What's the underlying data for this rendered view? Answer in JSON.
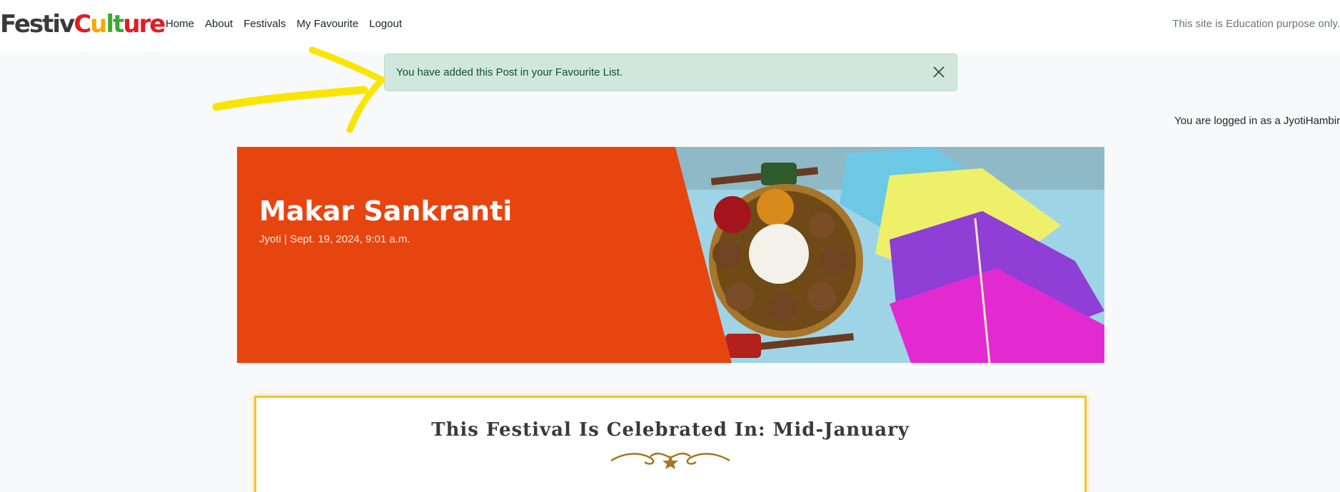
{
  "brand": {
    "part1": "Festiv",
    "c1": "C",
    "c2": "u",
    "c3": "lt",
    "c4": "ure"
  },
  "nav": {
    "items": [
      {
        "label": "Home"
      },
      {
        "label": "About"
      },
      {
        "label": "Festivals"
      },
      {
        "label": "My Favourite"
      },
      {
        "label": "Logout"
      }
    ],
    "note": "This site is Education purpose only."
  },
  "alert": {
    "message": "You have added this Post in your Favourite List."
  },
  "logged_in_text": "You are logged in as a JyotiHambir",
  "hero": {
    "title": "Makar Sankranti",
    "meta": "Jyoti | Sept. 19, 2024, 9:01 a.m."
  },
  "celebrate": {
    "title": "This Festival Is Celebrated In: Mid-January"
  },
  "colors": {
    "hero_bg": "#e74510",
    "alert_bg": "#d1e7dd",
    "alert_text": "#0f5132",
    "annotation": "#f9e500",
    "celebrate_border": "#f4c430"
  },
  "icons": {
    "alert_close": "close-icon",
    "annotation": "yellow-arrow-annotation",
    "flourish": "ornament-flourish-icon"
  }
}
